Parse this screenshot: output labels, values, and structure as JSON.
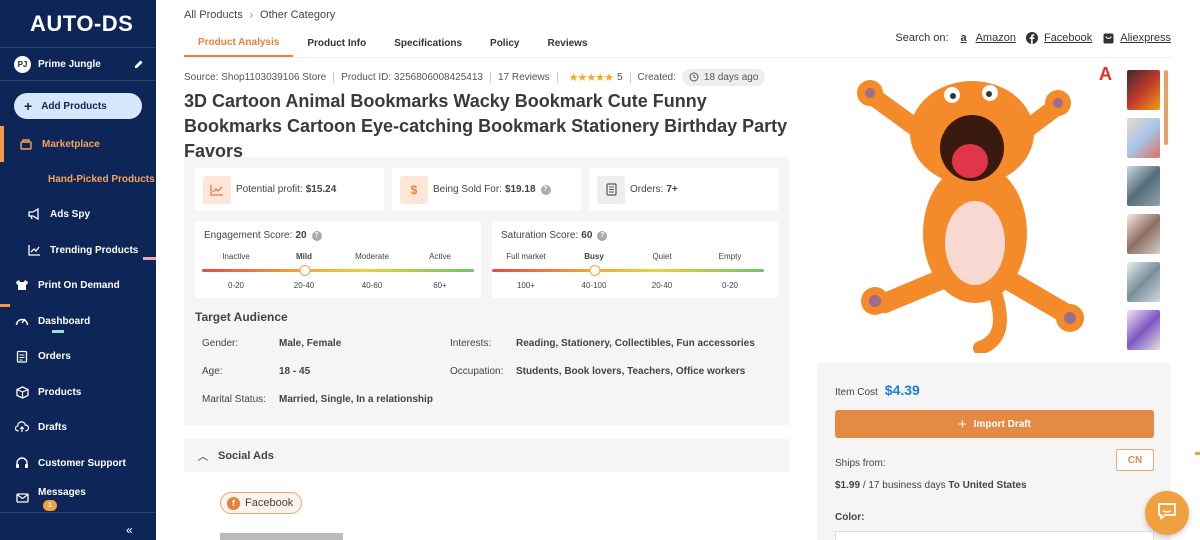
{
  "sidebar": {
    "logo": "AUTO-DS",
    "user": {
      "initials": "PJ",
      "name": "Prime Jungle"
    },
    "add_products": "Add Products",
    "items": [
      {
        "label": "Marketplace",
        "icon": "basket-icon",
        "active": true
      },
      {
        "label": "Hand-Picked Products",
        "icon": "",
        "sub": true
      },
      {
        "label": "Ads Spy",
        "icon": "megaphone-icon",
        "sub": true
      },
      {
        "label": "Trending Products",
        "icon": "trend-icon",
        "sub": true
      },
      {
        "label": "Print On Demand",
        "icon": "print-icon"
      },
      {
        "label": "Dashboard",
        "icon": "gauge-icon"
      },
      {
        "label": "Orders",
        "icon": "clipboard-icon"
      },
      {
        "label": "Products",
        "icon": "box-icon"
      },
      {
        "label": "Drafts",
        "icon": "cloud-upload-icon"
      },
      {
        "label": "Customer Support",
        "icon": "headset-icon"
      },
      {
        "label": "Messages",
        "icon": "envelope-icon"
      }
    ],
    "messages_badge": "1",
    "collapse": "«"
  },
  "breadcrumb": [
    "All Products",
    "Other Category"
  ],
  "tabs": [
    {
      "label": "Product Analysis",
      "active": true
    },
    {
      "label": "Product Info"
    },
    {
      "label": "Specifications"
    },
    {
      "label": "Policy"
    },
    {
      "label": "Reviews"
    }
  ],
  "search_on": {
    "label": "Search on:",
    "links": [
      {
        "label": "Amazon",
        "icon": "amazon-icon"
      },
      {
        "label": "Facebook",
        "icon": "facebook-icon"
      },
      {
        "label": "Aliexpress",
        "icon": "aliexpress-icon"
      }
    ]
  },
  "meta": {
    "source": "Source: Shop1103039106 Store",
    "product_id": "Product ID: 3256806008425413",
    "reviews": "17 Reviews",
    "rating": "5",
    "stars": 5,
    "created_label": "Created:",
    "created_value": "18 days ago"
  },
  "title": "3D Cartoon Animal Bookmarks Wacky Bookmark Cute Funny Bookmarks Cartoon Eye-catching Bookmark Stationery Birthday Party Favors",
  "stats": {
    "profit_label": "Potential profit:",
    "profit_value": "$15.24",
    "sold_label": "Being Sold For:",
    "sold_value": "$19.18",
    "orders_label": "Orders:",
    "orders_value": "7+"
  },
  "engagement": {
    "label": "Engagement Score:",
    "value": "20",
    "levels": [
      "Inactive",
      "Mild",
      "Moderate",
      "Active"
    ],
    "selected_level": "Mild",
    "ranges": [
      "0-20",
      "20-40",
      "40-60",
      "60+"
    ],
    "position": 0.38
  },
  "saturation": {
    "label": "Saturation Score:",
    "value": "60",
    "levels": [
      "Full market",
      "Busy",
      "Quiet",
      "Empty"
    ],
    "selected_level": "Busy",
    "ranges": [
      "100+",
      "40-100",
      "20-40",
      "0-20"
    ],
    "position": 0.38
  },
  "audience": {
    "title": "Target Audience",
    "gender_label": "Gender:",
    "gender_value": "Male, Female",
    "age_label": "Age:",
    "age_value": "18 - 45",
    "marital_label": "Marital Status:",
    "marital_value": "Married, Single, In a relationship",
    "interests_label": "Interests:",
    "interests_value": "Reading, Stationery, Collectibles, Fun accessories",
    "occupation_label": "Occupation:",
    "occupation_value": "Students, Book lovers, Teachers, Office workers"
  },
  "social_ads": {
    "title": "Social Ads",
    "chip": "Facebook"
  },
  "ali_logo": "A",
  "buy": {
    "item_cost_label": "Item Cost",
    "item_cost": "$4.39",
    "import_draft": "Import Draft",
    "ships_from_label": "Ships from:",
    "ships_from": "CN",
    "ship_price": "$1.99",
    "ship_days": "/ 17 business days",
    "ship_to": "To United States",
    "color_label": "Color:"
  },
  "colors": {
    "sidebar": "#0d2557",
    "accent": "#e8813a",
    "price": "#1e7fd9"
  }
}
